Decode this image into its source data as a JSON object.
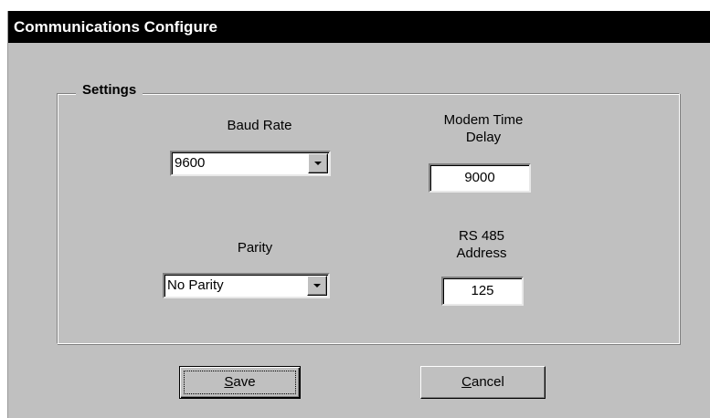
{
  "window": {
    "title": "Communications Configure"
  },
  "settings": {
    "group_label": "Settings",
    "baud_rate": {
      "label": "Baud Rate",
      "value": "9600"
    },
    "modem_time_delay": {
      "label": "Modem Time\nDelay",
      "value": "9000"
    },
    "parity": {
      "label": "Parity",
      "value": "No Parity"
    },
    "rs485_address": {
      "label": "RS 485\nAddress",
      "value": "125"
    }
  },
  "buttons": {
    "save": {
      "mnemonic": "S",
      "rest": "ave"
    },
    "cancel": {
      "mnemonic": "C",
      "rest": "ancel"
    }
  },
  "icons": {
    "dropdown": "chevron-down-icon"
  },
  "colors": {
    "titlebar_bg": "#000000",
    "titlebar_text": "#ffffff",
    "window_bg": "#c0c0c0",
    "field_bg": "#ffffff"
  }
}
